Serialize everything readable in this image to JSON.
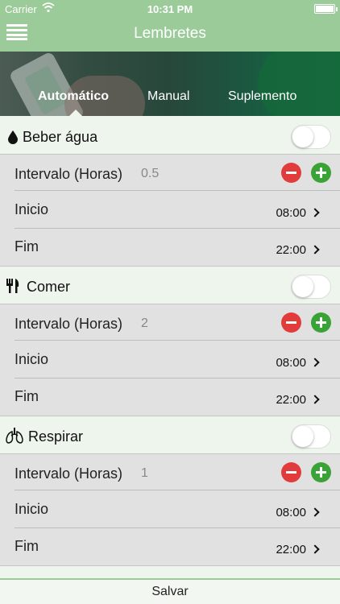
{
  "status_bar": {
    "carrier": "Carrier",
    "time": "10:31 PM"
  },
  "header": {
    "title": "Lembretes",
    "menu_icon": "hamburger-menu-icon"
  },
  "tabs": [
    {
      "label": "Automático",
      "active": true
    },
    {
      "label": "Manual",
      "active": false
    },
    {
      "label": "Suplemento",
      "active": false
    }
  ],
  "sections": [
    {
      "label": "Beber água",
      "icon": "water-drop-icon",
      "enabled": false,
      "interval_label": "Intervalo (Horas)",
      "interval_value": "0.5",
      "start_label": "Inicio",
      "start_value": "08:00",
      "end_label": "Fim",
      "end_value": "22:00"
    },
    {
      "label": "Comer",
      "icon": "fork-knife-icon",
      "enabled": false,
      "interval_label": "Intervalo (Horas)",
      "interval_value": "2",
      "start_label": "Inicio",
      "start_value": "08:00",
      "end_label": "Fim",
      "end_value": "22:00"
    },
    {
      "label": "Respirar",
      "icon": "lungs-icon",
      "enabled": false,
      "interval_label": "Intervalo (Horas)",
      "interval_value": "1",
      "start_label": "Inicio",
      "start_value": "08:00",
      "end_label": "Fim",
      "end_value": "22:00"
    }
  ],
  "footer": {
    "save_label": "Salvar"
  },
  "colors": {
    "header": "#9ccb9a",
    "minus": "#e23b3b",
    "plus": "#3aa335",
    "background": "#edf5ec"
  }
}
